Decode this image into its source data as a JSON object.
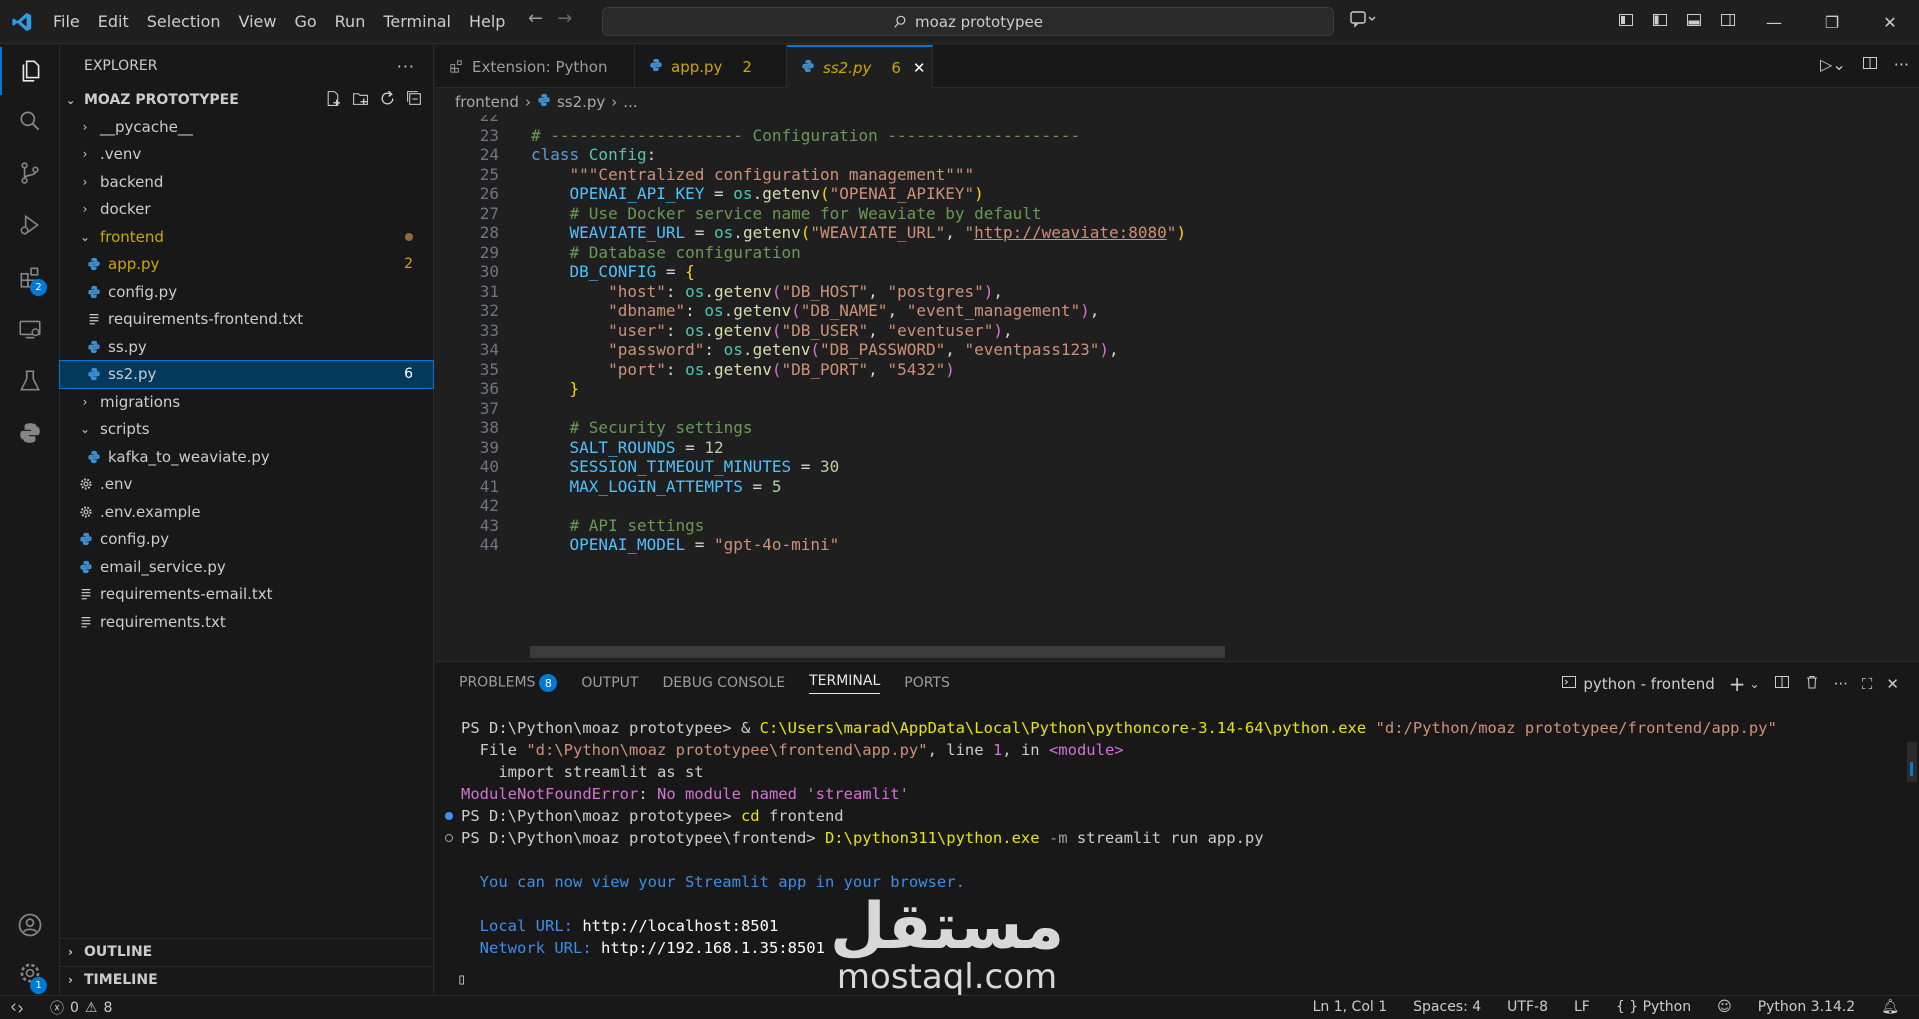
{
  "menu": [
    "File",
    "Edit",
    "Selection",
    "View",
    "Go",
    "Run",
    "Terminal",
    "Help"
  ],
  "search": {
    "text": "moaz prototypee"
  },
  "activity": {
    "extensions_badge": "2",
    "settings_badge": "1"
  },
  "explorer": {
    "title": "EXPLORER",
    "project": "MOAZ PROTOTYPEE",
    "items": [
      {
        "label": "__pycache__",
        "type": "folder",
        "open": false,
        "depth": 0
      },
      {
        "label": ".venv",
        "type": "folder",
        "open": false,
        "depth": 0
      },
      {
        "label": "backend",
        "type": "folder",
        "open": false,
        "depth": 0
      },
      {
        "label": "docker",
        "type": "folder",
        "open": false,
        "depth": 0
      },
      {
        "label": "frontend",
        "type": "folder",
        "open": true,
        "depth": 0,
        "color": "#cca700",
        "dot": true
      },
      {
        "label": "app.py",
        "type": "py",
        "depth": 1,
        "color": "#cca700",
        "count": "2"
      },
      {
        "label": "config.py",
        "type": "py",
        "depth": 1
      },
      {
        "label": "requirements-frontend.txt",
        "type": "txt",
        "depth": 1
      },
      {
        "label": "ss.py",
        "type": "py",
        "depth": 1
      },
      {
        "label": "ss2.py",
        "type": "py",
        "depth": 1,
        "count": "6",
        "selected": true
      },
      {
        "label": "migrations",
        "type": "folder",
        "open": false,
        "depth": 0
      },
      {
        "label": "scripts",
        "type": "folder",
        "open": true,
        "depth": 0
      },
      {
        "label": "kafka_to_weaviate.py",
        "type": "py",
        "depth": 1
      },
      {
        "label": ".env",
        "type": "gear",
        "depth": 0
      },
      {
        "label": ".env.example",
        "type": "gear",
        "depth": 0
      },
      {
        "label": "config.py",
        "type": "py",
        "depth": 0
      },
      {
        "label": "email_service.py",
        "type": "py",
        "depth": 0
      },
      {
        "label": "requirements-email.txt",
        "type": "txt",
        "depth": 0
      },
      {
        "label": "requirements.txt",
        "type": "txt",
        "depth": 0
      }
    ],
    "outline": "OUTLINE",
    "timeline": "TIMELINE"
  },
  "tabs": [
    {
      "label": "Extension: Python",
      "mod": ""
    },
    {
      "label": "app.py",
      "mod": "2"
    },
    {
      "label": "ss2.py",
      "mod": "6"
    }
  ],
  "breadcrumb": {
    "folder": "frontend",
    "file": "ss2.py",
    "more": "..."
  },
  "code": [
    {
      "n": "22",
      "t": []
    },
    {
      "n": "23",
      "t": [
        [
          "c-com",
          "# -------------------- Configuration --------------------"
        ]
      ]
    },
    {
      "n": "24",
      "t": [
        [
          "c-kw",
          "class "
        ],
        [
          "c-cls",
          "Config"
        ],
        [
          "c-txt",
          ":"
        ]
      ]
    },
    {
      "n": "25",
      "t": [
        [
          "c-txt",
          "    "
        ],
        [
          "c-str",
          "\"\"\"Centralized configuration management\"\"\""
        ]
      ]
    },
    {
      "n": "26",
      "t": [
        [
          "c-txt",
          "    "
        ],
        [
          "c-var",
          "OPENAI_API_KEY"
        ],
        [
          "c-txt",
          " = "
        ],
        [
          "c-cls",
          "os"
        ],
        [
          "c-txt",
          "."
        ],
        [
          "c-fn",
          "getenv"
        ],
        [
          "c-br1",
          "("
        ],
        [
          "c-str",
          "\"OPENAI_APIKEY\""
        ],
        [
          "c-br1",
          ")"
        ]
      ]
    },
    {
      "n": "27",
      "t": [
        [
          "c-txt",
          "    "
        ],
        [
          "c-com",
          "# Use Docker service name for Weaviate by default"
        ]
      ]
    },
    {
      "n": "28",
      "t": [
        [
          "c-txt",
          "    "
        ],
        [
          "c-var",
          "WEAVIATE_URL"
        ],
        [
          "c-txt",
          " = "
        ],
        [
          "c-cls",
          "os"
        ],
        [
          "c-txt",
          "."
        ],
        [
          "c-fn",
          "getenv"
        ],
        [
          "c-br1",
          "("
        ],
        [
          "c-str",
          "\"WEAVIATE_URL\""
        ],
        [
          "c-txt",
          ", "
        ],
        [
          "c-str",
          "\""
        ],
        [
          "c-str url",
          "http://weaviate:8080"
        ],
        [
          "c-str",
          "\""
        ],
        [
          "c-br1",
          ")"
        ]
      ]
    },
    {
      "n": "29",
      "t": [
        [
          "c-txt",
          "    "
        ],
        [
          "c-com",
          "# Database configuration"
        ]
      ]
    },
    {
      "n": "30",
      "t": [
        [
          "c-txt",
          "    "
        ],
        [
          "c-var",
          "DB_CONFIG"
        ],
        [
          "c-txt",
          " = "
        ],
        [
          "c-br1",
          "{"
        ]
      ]
    },
    {
      "n": "31",
      "t": [
        [
          "c-txt",
          "        "
        ],
        [
          "c-str",
          "\"host\""
        ],
        [
          "c-txt",
          ": "
        ],
        [
          "c-cls",
          "os"
        ],
        [
          "c-txt",
          "."
        ],
        [
          "c-fn",
          "getenv"
        ],
        [
          "c-br2",
          "("
        ],
        [
          "c-str",
          "\"DB_HOST\""
        ],
        [
          "c-txt",
          ", "
        ],
        [
          "c-str",
          "\"postgres\""
        ],
        [
          "c-br2",
          ")"
        ],
        [
          "c-txt",
          ","
        ]
      ]
    },
    {
      "n": "32",
      "t": [
        [
          "c-txt",
          "        "
        ],
        [
          "c-str",
          "\"dbname\""
        ],
        [
          "c-txt",
          ": "
        ],
        [
          "c-cls",
          "os"
        ],
        [
          "c-txt",
          "."
        ],
        [
          "c-fn",
          "getenv"
        ],
        [
          "c-br2",
          "("
        ],
        [
          "c-str",
          "\"DB_NAME\""
        ],
        [
          "c-txt",
          ", "
        ],
        [
          "c-str",
          "\"event_management\""
        ],
        [
          "c-br2",
          ")"
        ],
        [
          "c-txt",
          ","
        ]
      ]
    },
    {
      "n": "33",
      "t": [
        [
          "c-txt",
          "        "
        ],
        [
          "c-str",
          "\"user\""
        ],
        [
          "c-txt",
          ": "
        ],
        [
          "c-cls",
          "os"
        ],
        [
          "c-txt",
          "."
        ],
        [
          "c-fn",
          "getenv"
        ],
        [
          "c-br2",
          "("
        ],
        [
          "c-str",
          "\"DB_USER\""
        ],
        [
          "c-txt",
          ", "
        ],
        [
          "c-str",
          "\"eventuser\""
        ],
        [
          "c-br2",
          ")"
        ],
        [
          "c-txt",
          ","
        ]
      ]
    },
    {
      "n": "34",
      "t": [
        [
          "c-txt",
          "        "
        ],
        [
          "c-str",
          "\"password\""
        ],
        [
          "c-txt",
          ": "
        ],
        [
          "c-cls",
          "os"
        ],
        [
          "c-txt",
          "."
        ],
        [
          "c-fn",
          "getenv"
        ],
        [
          "c-br2",
          "("
        ],
        [
          "c-str",
          "\"DB_PASSWORD\""
        ],
        [
          "c-txt",
          ", "
        ],
        [
          "c-str",
          "\"eventpass123\""
        ],
        [
          "c-br2",
          ")"
        ],
        [
          "c-txt",
          ","
        ]
      ]
    },
    {
      "n": "35",
      "t": [
        [
          "c-txt",
          "        "
        ],
        [
          "c-str",
          "\"port\""
        ],
        [
          "c-txt",
          ": "
        ],
        [
          "c-cls",
          "os"
        ],
        [
          "c-txt",
          "."
        ],
        [
          "c-fn",
          "getenv"
        ],
        [
          "c-br2",
          "("
        ],
        [
          "c-str",
          "\"DB_PORT\""
        ],
        [
          "c-txt",
          ", "
        ],
        [
          "c-str",
          "\"5432\""
        ],
        [
          "c-br2",
          ")"
        ]
      ]
    },
    {
      "n": "36",
      "t": [
        [
          "c-txt",
          "    "
        ],
        [
          "c-br1",
          "}"
        ]
      ]
    },
    {
      "n": "37",
      "t": []
    },
    {
      "n": "38",
      "t": [
        [
          "c-txt",
          "    "
        ],
        [
          "c-com",
          "# Security settings"
        ]
      ]
    },
    {
      "n": "39",
      "t": [
        [
          "c-txt",
          "    "
        ],
        [
          "c-var",
          "SALT_ROUNDS"
        ],
        [
          "c-txt",
          " = "
        ],
        [
          "c-num",
          "12"
        ]
      ]
    },
    {
      "n": "40",
      "t": [
        [
          "c-txt",
          "    "
        ],
        [
          "c-var",
          "SESSION_TIMEOUT_MINUTES"
        ],
        [
          "c-txt",
          " = "
        ],
        [
          "c-num",
          "30"
        ]
      ]
    },
    {
      "n": "41",
      "t": [
        [
          "c-txt",
          "    "
        ],
        [
          "c-var",
          "MAX_LOGIN_ATTEMPTS"
        ],
        [
          "c-txt",
          " = "
        ],
        [
          "c-num",
          "5"
        ]
      ]
    },
    {
      "n": "42",
      "t": []
    },
    {
      "n": "43",
      "t": [
        [
          "c-txt",
          "    "
        ],
        [
          "c-com",
          "# API settings"
        ]
      ]
    },
    {
      "n": "44",
      "t": [
        [
          "c-txt",
          "    "
        ],
        [
          "c-var",
          "OPENAI_MODEL"
        ],
        [
          "c-txt",
          " = "
        ],
        [
          "c-str",
          "\"gpt-4o-mini\""
        ]
      ]
    }
  ],
  "panel": {
    "tabs": [
      "PROBLEMS",
      "OUTPUT",
      "DEBUG CONSOLE",
      "TERMINAL",
      "PORTS"
    ],
    "problems_count": "8",
    "terminal_name": "python - frontend",
    "lines": [
      [
        [
          "",
          "PS D:\\Python\\moaz prototypee> & "
        ],
        [
          "t-yel",
          "C:\\Users\\marad\\AppData\\Local\\Python\\pythoncore-3.14-64\\python.exe"
        ],
        [
          "",
          " "
        ],
        [
          "t-str",
          "\"d:/Python/moaz prototypee/frontend/app.py\""
        ]
      ],
      [
        [
          "",
          "  File "
        ],
        [
          "t-str",
          "\"d:\\Python\\moaz prototypee\\frontend\\app.py\""
        ],
        [
          "",
          ", line "
        ],
        [
          "t-mag",
          "1"
        ],
        [
          "",
          ", in "
        ],
        [
          "t-mag",
          "<module>"
        ]
      ],
      [
        [
          "",
          "    import streamlit as st"
        ]
      ],
      [
        [
          "t-file",
          "ModuleNotFoundError"
        ],
        [
          "",
          ": "
        ],
        [
          "t-mag",
          "No module named 'streamlit'"
        ]
      ],
      [
        [
          "",
          "PS D:\\Python\\moaz prototypee> "
        ],
        [
          "t-yel",
          "cd"
        ],
        [
          "",
          " frontend"
        ]
      ],
      [
        [
          "",
          "PS D:\\Python\\moaz prototypee\\frontend> "
        ],
        [
          "t-yel",
          "D:\\python311\\python.exe"
        ],
        [
          "t-dim",
          " -m"
        ],
        [
          "",
          " streamlit run app.py"
        ]
      ],
      [],
      [
        [
          "t-blue",
          "  You can now view your Streamlit app in your browser."
        ]
      ],
      [],
      [
        [
          "t-blue",
          "  Local URL: "
        ],
        [
          "t-link",
          "http://localhost:8501"
        ]
      ],
      [
        [
          "t-blue",
          "  Network URL: "
        ],
        [
          "t-link",
          "http://192.168.1.35:8501"
        ]
      ]
    ]
  },
  "watermark": {
    "arabic": "مستقل",
    "latin": "mostaql.com"
  },
  "status": {
    "errors": "0",
    "warnings": "8",
    "position": "Ln 1, Col 1",
    "spaces": "Spaces: 4",
    "encoding": "UTF-8",
    "eol": "LF",
    "language": "Python",
    "interpreter": "Python 3.14.2"
  }
}
